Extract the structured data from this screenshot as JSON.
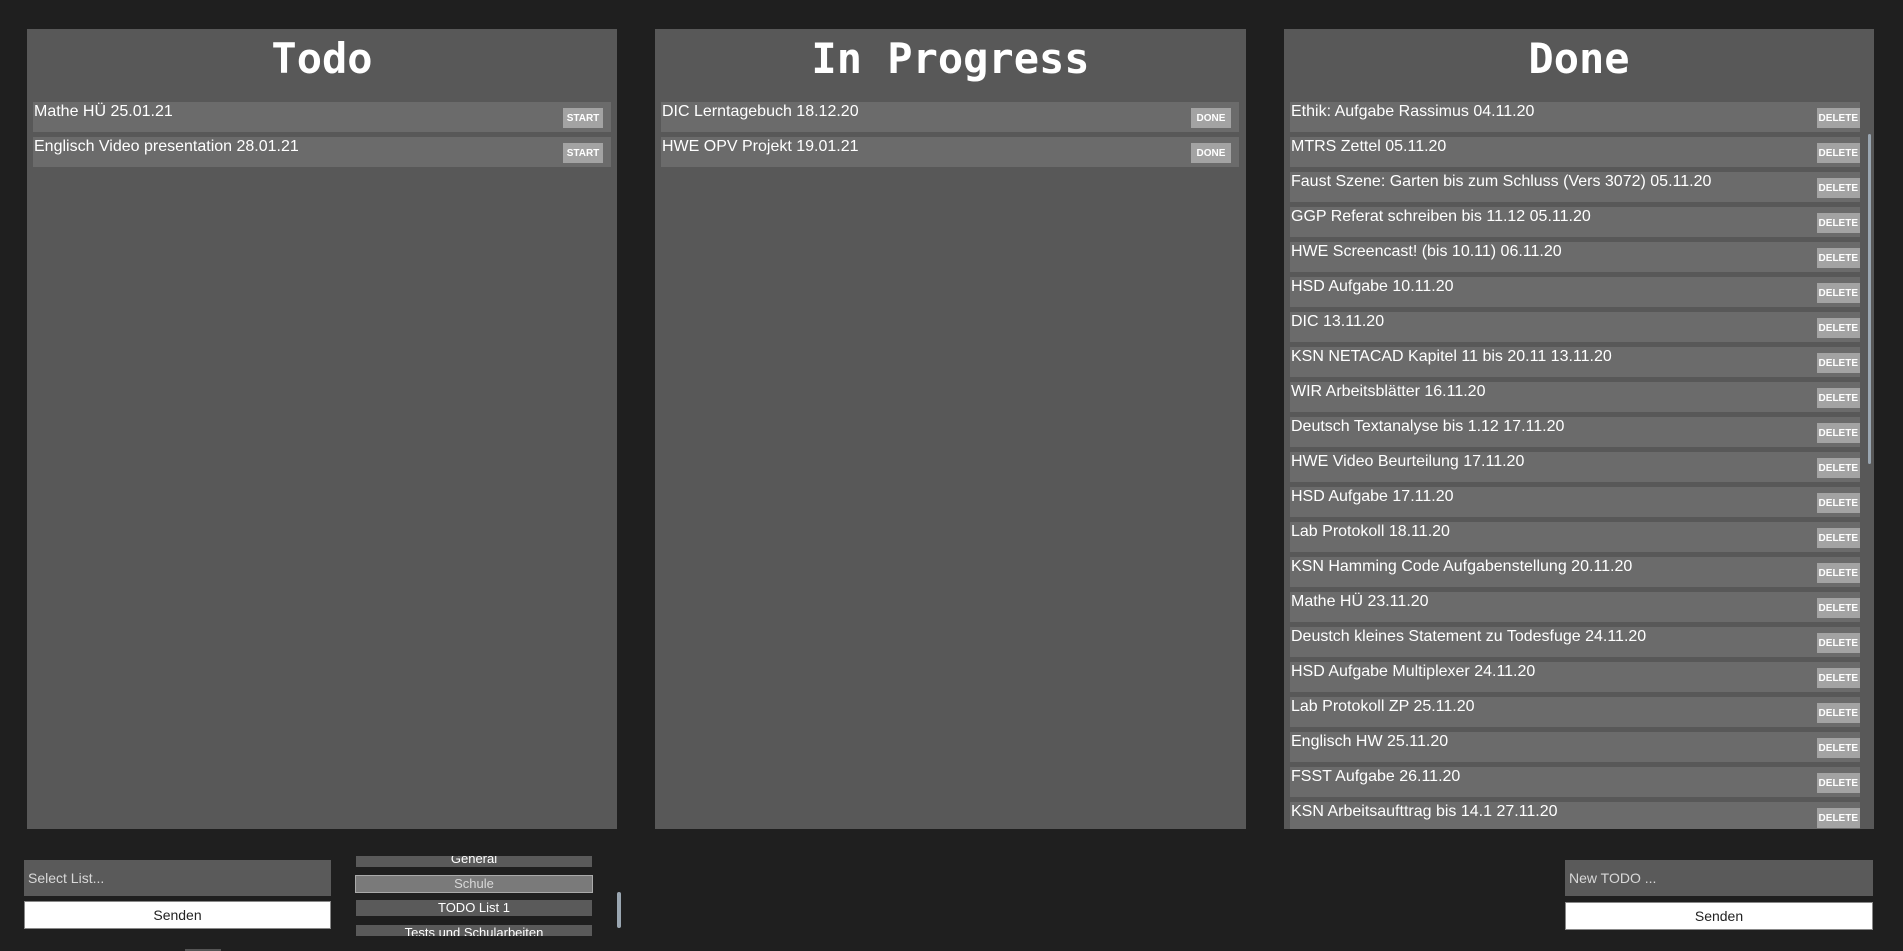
{
  "columns": {
    "todo": {
      "title": "Todo",
      "items": [
        {
          "label": "Mathe HÜ 25.01.21",
          "button": "START"
        },
        {
          "label": "Englisch Video presentation 28.01.21",
          "button": "START"
        }
      ]
    },
    "in_progress": {
      "title": "In Progress",
      "items": [
        {
          "label": "DIC Lerntagebuch 18.12.20",
          "button": "DONE"
        },
        {
          "label": "HWE OPV Projekt 19.01.21",
          "button": "DONE"
        }
      ]
    },
    "done": {
      "title": "Done",
      "items": [
        {
          "label": "Ethik: Aufgabe Rassimus 04.11.20",
          "button": "DELETE"
        },
        {
          "label": "MTRS Zettel 05.11.20",
          "button": "DELETE"
        },
        {
          "label": "Faust Szene: Garten bis zum Schluss (Vers 3072) 05.11.20",
          "button": "DELETE"
        },
        {
          "label": "GGP Referat schreiben bis 11.12 05.11.20",
          "button": "DELETE"
        },
        {
          "label": "HWE Screencast! (bis 10.11) 06.11.20",
          "button": "DELETE"
        },
        {
          "label": "HSD Aufgabe 10.11.20",
          "button": "DELETE"
        },
        {
          "label": "DIC 13.11.20",
          "button": "DELETE"
        },
        {
          "label": "KSN NETACAD Kapitel 11 bis 20.11 13.11.20",
          "button": "DELETE"
        },
        {
          "label": "WIR Arbeitsblätter 16.11.20",
          "button": "DELETE"
        },
        {
          "label": "Deutsch Textanalyse bis 1.12 17.11.20",
          "button": "DELETE"
        },
        {
          "label": "HWE Video Beurteilung 17.11.20",
          "button": "DELETE"
        },
        {
          "label": "HSD Aufgabe 17.11.20",
          "button": "DELETE"
        },
        {
          "label": "Lab Protokoll 18.11.20",
          "button": "DELETE"
        },
        {
          "label": "KSN Hamming Code Aufgabenstellung 20.11.20",
          "button": "DELETE"
        },
        {
          "label": "Mathe HÜ 23.11.20",
          "button": "DELETE"
        },
        {
          "label": "Deustch kleines Statement zu Todesfuge 24.11.20",
          "button": "DELETE"
        },
        {
          "label": "HSD Aufgabe Multiplexer 24.11.20",
          "button": "DELETE"
        },
        {
          "label": "Lab Protokoll ZP 25.11.20",
          "button": "DELETE"
        },
        {
          "label": "Englisch HW 25.11.20",
          "button": "DELETE"
        },
        {
          "label": "FSST Aufgabe 26.11.20",
          "button": "DELETE"
        },
        {
          "label": "KSN Arbeitsaufttrag bis 14.1 27.11.20",
          "button": "DELETE"
        }
      ]
    }
  },
  "list_select": {
    "placeholder": "Select List...",
    "send_label": "Senden",
    "options": [
      "General",
      "Schule",
      "TODO List 1",
      "Tests und Schularbeiten"
    ],
    "selected": "Schule"
  },
  "new_todo": {
    "placeholder": "New TODO ...",
    "send_label": "Senden"
  }
}
